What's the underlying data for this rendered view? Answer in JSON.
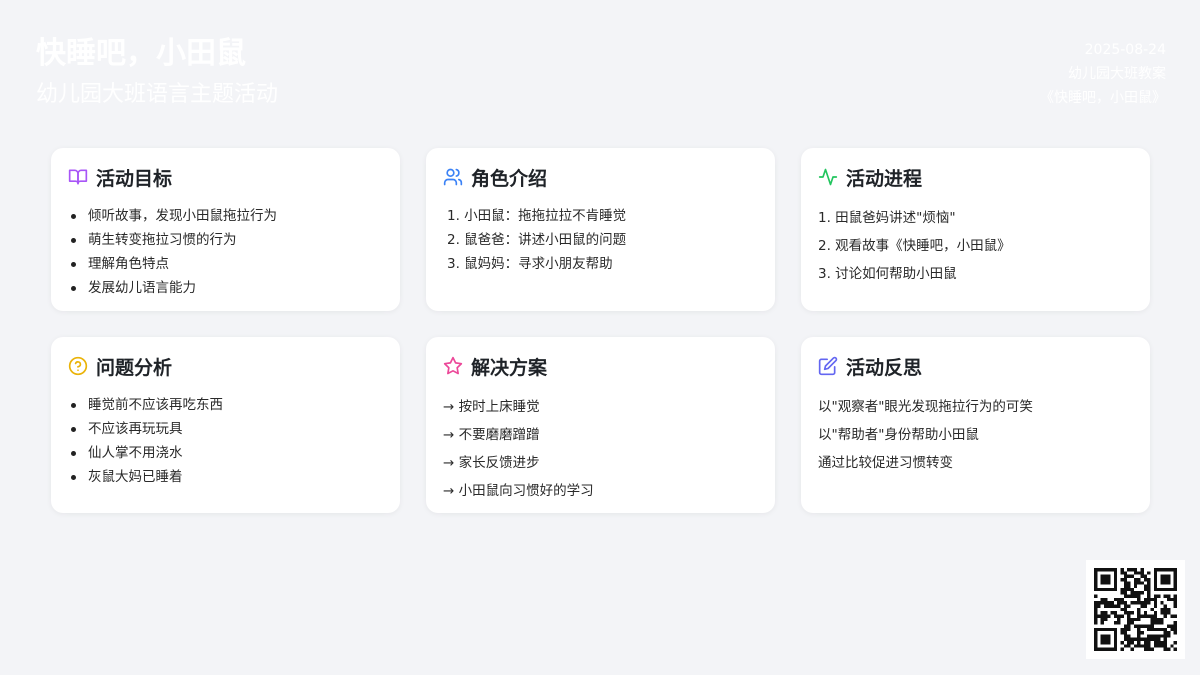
{
  "header": {
    "title": "快睡吧，小田鼠",
    "subtitle": "幼儿园大班语言主题活动"
  },
  "meta": {
    "date": "2025-08-24",
    "type": "幼儿园大班教案",
    "book": "《快睡吧，小田鼠》"
  },
  "cards": [
    {
      "title": "活动目标",
      "icon": "book-open-icon",
      "icon_color": "#a855f7",
      "items": [
        "倾听故事，发现小田鼠拖拉行为",
        "萌生转变拖拉习惯的行为",
        "理解角色特点",
        "发展幼儿语言能力"
      ]
    },
    {
      "title": "角色介绍",
      "icon": "users-icon",
      "icon_color": "#3b82f6",
      "items": [
        "1. 小田鼠：拖拖拉拉不肯睡觉",
        "2. 鼠爸爸：讲述小田鼠的问题",
        "3. 鼠妈妈：寻求小朋友帮助"
      ]
    },
    {
      "title": "活动进程",
      "icon": "activity-icon",
      "icon_color": "#22c55e",
      "items": [
        "1. 田鼠爸妈讲述\"烦恼\"",
        "2. 观看故事《快睡吧，小田鼠》",
        "3. 讨论如何帮助小田鼠"
      ]
    },
    {
      "title": "问题分析",
      "icon": "question-circle-icon",
      "icon_color": "#eab308",
      "items": [
        "睡觉前不应该再吃东西",
        "不应该再玩玩具",
        "仙人掌不用浇水",
        "灰鼠大妈已睡着"
      ]
    },
    {
      "title": "解决方案",
      "icon": "star-icon",
      "icon_color": "#ec4899",
      "items": [
        "→ 按时上床睡觉",
        "→ 不要磨磨蹭蹭",
        "→ 家长反馈进步",
        "→ 小田鼠向习惯好的学习"
      ]
    },
    {
      "title": "活动反思",
      "icon": "edit-icon",
      "icon_color": "#6366f1",
      "items": [
        "以\"观察者\"眼光发现拖拉行为的可笑",
        "以\"帮助者\"身份帮助小田鼠",
        "通过比较促进习惯转变"
      ]
    }
  ]
}
